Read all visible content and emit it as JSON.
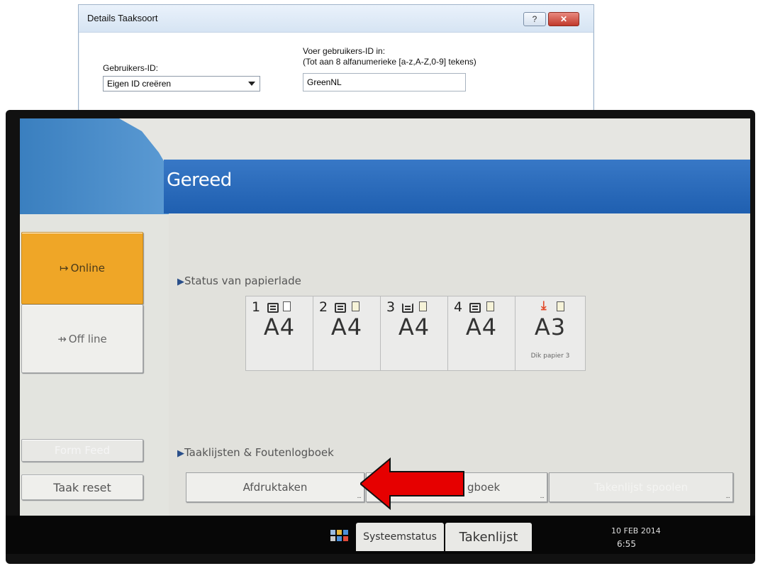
{
  "dialog": {
    "title": "Details Taaksoort",
    "help_label": "?",
    "close_label": "✕",
    "userid_label": "Gebruikers-ID:",
    "userid_select_value": "Eigen ID creëren",
    "instruction_line1": "Voer gebruikers-ID in:",
    "instruction_line2": "(Tot aan 8 alfanumerieke [a-z,A-Z,0-9] tekens)",
    "userid_value": "GreenNL"
  },
  "panel": {
    "title": "Gereed",
    "side_buttons": {
      "online": "Online",
      "offline": "Off line",
      "form_feed": "Form Feed",
      "taak_reset": "Taak reset"
    },
    "tray_section_title": "Status van papierlade",
    "trays": [
      {
        "number": "1",
        "size": "A4",
        "sub": ""
      },
      {
        "number": "2",
        "size": "A4",
        "sub": ""
      },
      {
        "number": "3",
        "size": "A4",
        "sub": ""
      },
      {
        "number": "4",
        "size": "A4",
        "sub": ""
      },
      {
        "number": "",
        "size": "A3",
        "sub": "Dik papier 3"
      }
    ],
    "joblist_section_title": "Taaklijsten & Foutenlogboek",
    "commands": {
      "afdruktaken": "Afdruktaken",
      "foutenlogboek": "gboek",
      "spoolen": "Takenlijst spoolen"
    },
    "bottom": {
      "systeemstatus": "Systeemstatus",
      "takenlijst": "Takenlijst",
      "date": "10 FEB  2014",
      "time": "6:55"
    }
  },
  "colors": {
    "title_bar": "#1f5fb0",
    "online_active": "#efa627",
    "pointer_arrow": "#e60000"
  }
}
